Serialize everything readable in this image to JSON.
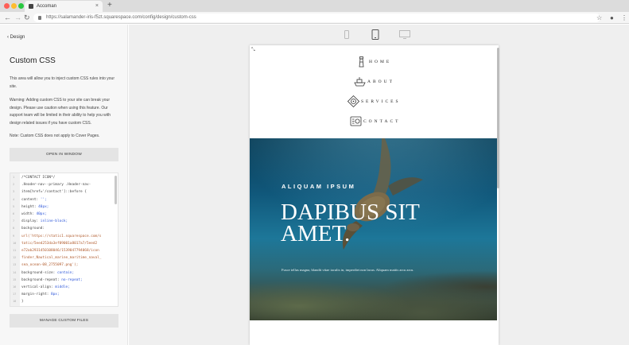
{
  "browser": {
    "tab_title": "Accoman",
    "url": "https://salamander-iris-f5zt.squarespace.com/config/design/custom-css",
    "new_tab": "+",
    "close_tab": "×",
    "colors": {
      "close": "#fe5f57",
      "minimize": "#febc2e",
      "maximize": "#28c840"
    },
    "icons": [
      "back-arrow-icon",
      "forward-arrow-icon",
      "reload-icon",
      "lock-icon",
      "star-icon",
      "profile-icon",
      "menu-icon"
    ]
  },
  "sidebar": {
    "back_label": "Design",
    "title": "Custom CSS",
    "intro": "This area will allow you to inject custom CSS rules into your site.",
    "warning": "Warning: Adding custom CSS to your site can break your design. Please use caution when using this feature. Our support team will be limited in their ability to help you with design related issues if you have custom CSS.",
    "note": "Note: Custom CSS does not apply to Cover Pages.",
    "open_button": "OPEN IN WINDOW",
    "manage_button": "MANAGE CUSTOM FILES",
    "code_lines": [
      "/*CONTACT ICON*/",
      ".Header-nav--primary .Header-nav-",
      "item[href='/contact']::before {",
      "  content: '';",
      "  height: 40px;",
      "  width: 40px;",
      "  display: inline-block;",
      "  background:",
      "url('https://static1.squarespace.com/s",
      "tatic/5eed253da3ef09001a8017a7/5eed2",
      "e72ab2931450108046/1539047794068/icon",
      "finder_Nautical_marine_maritime_naval_",
      "sea_ocean-08_2755097.png');",
      "  background-size: contain;",
      "  background-repeat: no-repeat;",
      "  vertical-align: middle;",
      "  margin-right: 8px;",
      "}"
    ],
    "line_numbers": [
      "1",
      "2",
      "3",
      "4",
      "5",
      "6",
      "7",
      "8",
      "9",
      "10",
      "11",
      "12",
      "13",
      "14",
      "15",
      "16",
      "17",
      "18"
    ]
  },
  "preview": {
    "devices": [
      "mobile-device-icon",
      "tablet-device-icon",
      "desktop-device-icon"
    ],
    "active_device": "tablet-device-icon",
    "resize_glyph": "⤡",
    "nav": [
      {
        "label": "HOME",
        "icon": "lighthouse-icon"
      },
      {
        "label": "ABOUT",
        "icon": "ship-icon"
      },
      {
        "label": "SERVICES",
        "icon": "compass-icon"
      },
      {
        "label": "CONTACT",
        "icon": "radio-icon"
      }
    ],
    "hero": {
      "eyebrow": "ALIQUAM IPSUM",
      "heading_line1": "DAPIBUS SIT",
      "heading_line2": "AMET.",
      "body": "Fusce tellus magna, blandit vitae iaculis in, imperdiet non lacus. Aliquam mattis arcu arcu."
    }
  }
}
